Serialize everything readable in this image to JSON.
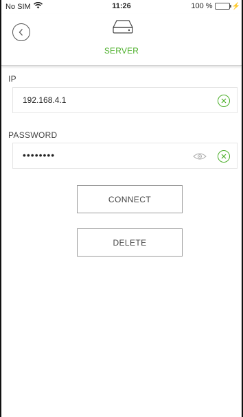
{
  "status_bar": {
    "carrier": "No SIM",
    "time": "11:26",
    "battery": "100 %",
    "battery_level": 1.0,
    "battery_color": "#3cc13b"
  },
  "nav": {
    "title": "SERVER",
    "back_icon": "chevron-left-icon",
    "title_icon": "hard-drive-icon",
    "accent_color": "#4caf2a"
  },
  "form": {
    "ip": {
      "label": "IP",
      "value": "192.168.4.1",
      "clear_icon": "clear-icon"
    },
    "password": {
      "label": "PASSWORD",
      "value": "••••••••",
      "toggle_icon": "eye-icon",
      "clear_icon": "clear-icon"
    }
  },
  "buttons": {
    "connect": "CONNECT",
    "delete": "DELETE"
  }
}
